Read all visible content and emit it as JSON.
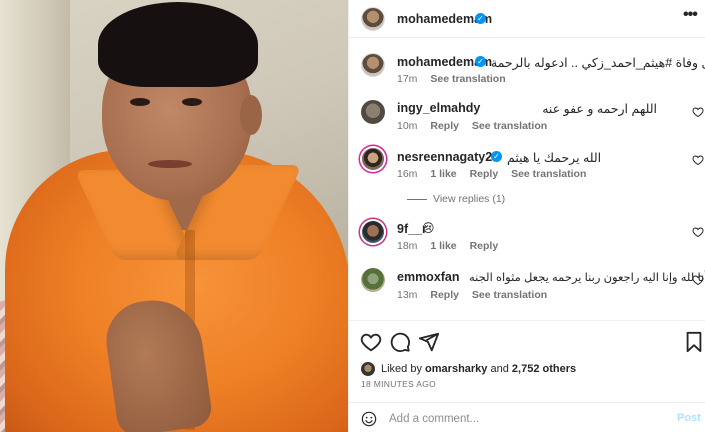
{
  "post": {
    "author": "mohamedemam",
    "caption": "ذكرى وفاة #هيثم_احمد_زكي .. ادعوله بالرحمة",
    "caption_time": "17m",
    "see_translation": "See translation"
  },
  "comments": [
    {
      "username": "ingy_elmahdy",
      "text": "اللهم ارحمه و عفو عنه",
      "time": "10m",
      "likes": "",
      "reply": "Reply",
      "translation": "See translation"
    },
    {
      "username": "nesreennagaty2",
      "verified": true,
      "text": "الله يرحمك يا هيثم",
      "time": "16m",
      "likes": "1 like",
      "reply": "Reply",
      "translation": "See translation"
    },
    {
      "username": "9f__r",
      "text": "😢",
      "time": "18m",
      "likes": "1 like",
      "reply": "Reply",
      "translation": ""
    },
    {
      "username": "emmoxfan",
      "text": "أنا لله وإنا اليه راجعون ربنا يرحمه يجعل مثواه الجنه",
      "time": "13m",
      "likes": "",
      "reply": "Reply",
      "translation": "See translation"
    }
  ],
  "view_replies": "View replies (1)",
  "likes": {
    "prefix": "Liked by",
    "user": "omarsharky",
    "and": "and",
    "count": "2,752 others"
  },
  "time_ago": "18 MINUTES AGO",
  "add_comment": {
    "placeholder": "Add a comment...",
    "post_label": "Post"
  },
  "colors": {
    "verified": "#0095f6",
    "post_disabled": "#b2dffc",
    "muted": "#737373"
  }
}
